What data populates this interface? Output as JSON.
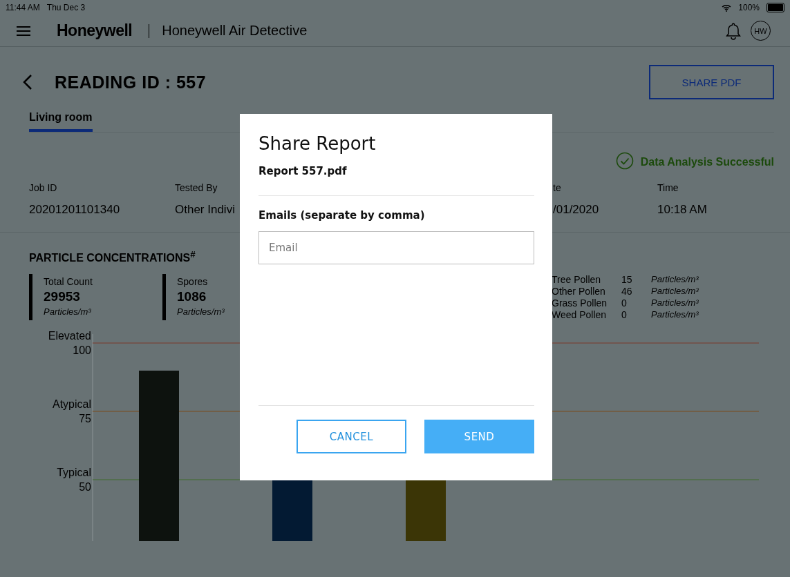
{
  "status_bar": {
    "time": "11:44 AM",
    "date": "Thu Dec 3",
    "battery": "100%"
  },
  "header": {
    "logo": "Honeywell",
    "app_title": "Honeywell Air Detective",
    "avatar": "HW"
  },
  "page": {
    "title": "READING ID : 557",
    "share_button": "SHARE PDF"
  },
  "tabs": [
    {
      "label": "Living room",
      "selected": true
    }
  ],
  "analysis_status": "Data Analysis Successful",
  "details": [
    {
      "label": "Job ID",
      "value": "20201201101340"
    },
    {
      "label": "Tested By",
      "value": "Other Indivi"
    },
    {
      "label": "te",
      "value": "/01/2020"
    },
    {
      "label": "Time",
      "value": "10:18 AM"
    }
  ],
  "section_title": "PARTICLE CONCENTRATIONS$^{#}$",
  "summary": [
    {
      "label": "Total Count",
      "value": "29953",
      "unit": "Particles/m³"
    },
    {
      "label": "Spores",
      "value": "1086",
      "unit": "Particles/m³"
    }
  ],
  "pollen": [
    {
      "name": "Tree Pollen",
      "value": "15",
      "unit": "Particles/m³"
    },
    {
      "name": "Other Pollen",
      "value": "46",
      "unit": "Particles/m³"
    },
    {
      "name": "Grass Pollen",
      "value": "0",
      "unit": "Particles/m³"
    },
    {
      "name": "Weed Pollen",
      "value": "0",
      "unit": "Particles/m³"
    }
  ],
  "chart": {
    "levels": [
      {
        "label": "Elevated",
        "tick": "100"
      },
      {
        "label": "Atypical",
        "tick": "75"
      },
      {
        "label": "Typical",
        "tick": "50"
      }
    ]
  },
  "dialog": {
    "title": "Share Report",
    "file": "Report 557.pdf",
    "emails_label": "Emails (separate by comma)",
    "email_placeholder": "Email",
    "cancel": "CANCEL",
    "send": "SEND"
  }
}
